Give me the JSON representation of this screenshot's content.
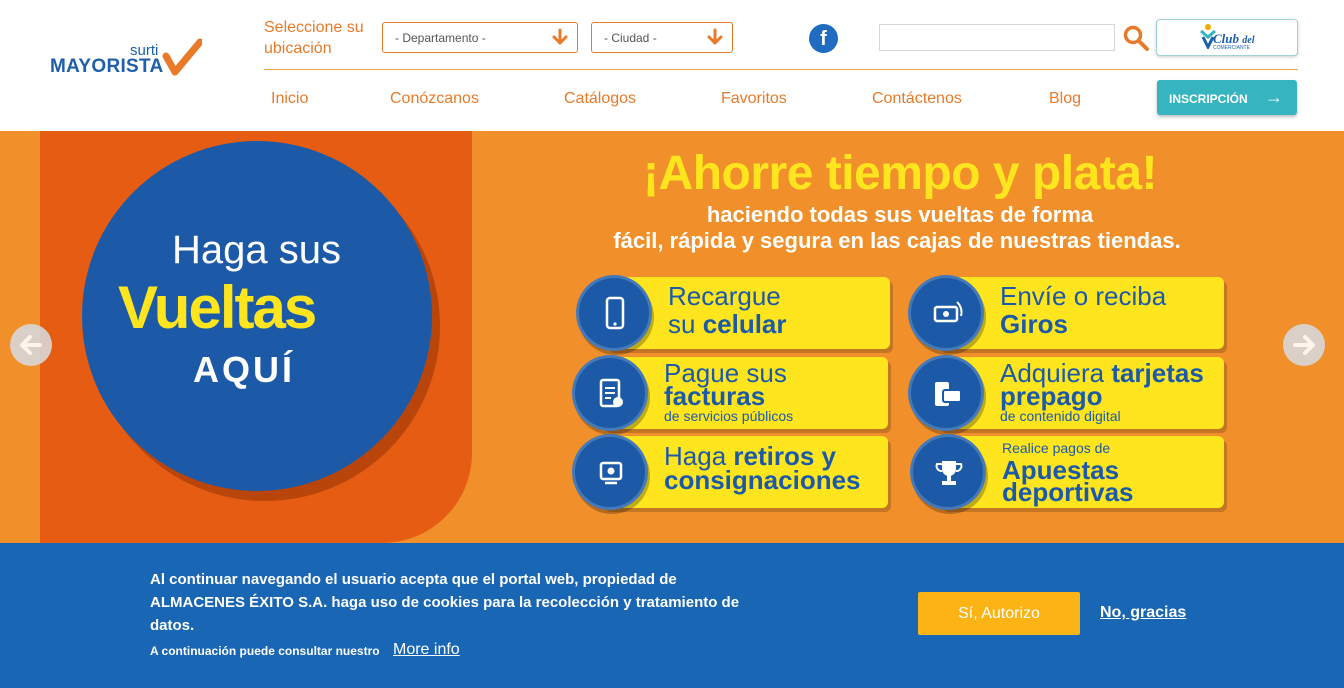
{
  "logo": {
    "small": "surti",
    "main": "MAYORISTA"
  },
  "location": {
    "label": "Seleccione su ubicación",
    "departamento": "- Departamento -",
    "ciudad": "- Ciudad -"
  },
  "social": {
    "facebook_glyph": "f"
  },
  "search": {
    "value": "",
    "placeholder": ""
  },
  "club": {
    "text": "Club",
    "text_del": "del",
    "small": "COMERCIANTE"
  },
  "nav": {
    "items": [
      "Inicio",
      "Conózcanos",
      "Catálogos",
      "Favoritos",
      "Contáctenos",
      "Blog"
    ],
    "inscripcion": "INSCRIPCIÓN"
  },
  "banner": {
    "circle": {
      "line1": "Haga sus",
      "line2": "Vueltas",
      "line3": "AQUÍ"
    },
    "headline": "¡Ahorre tiempo y plata!",
    "sub1": "haciendo todas sus vueltas de forma",
    "sub2": "fácil, rápida y segura en las cajas de nuestras tiendas.",
    "cards": {
      "recargue": {
        "l1": "Recargue",
        "l2a": "su ",
        "l2b": "celular"
      },
      "envie": {
        "l1": "Envíe o reciba",
        "l2": "Giros"
      },
      "pague": {
        "l1": "Pague sus",
        "l2": "facturas",
        "small": "de servicios públicos"
      },
      "adquiera": {
        "l1a": "Adquiera ",
        "l1b": "tarjetas",
        "l2": "prepago",
        "small": "de contenido digital"
      },
      "retiros": {
        "l1a": "Haga ",
        "l1b": "retiros y",
        "l2": "consignaciones"
      },
      "apuestas": {
        "top": "Realice pagos de",
        "l1": "Apuestas",
        "l2": "deportivas"
      }
    }
  },
  "cookie": {
    "text": "Al continuar navegando el usuario acepta que el portal web, propiedad de ALMACENES ÉXITO S.A. haga uso de cookies para la recolección y tratamiento de datos.",
    "small": "A continuación puede consultar nuestro",
    "more_info": "More info",
    "accept": "Sí, Autorizo",
    "decline": "No, gracias"
  },
  "colors": {
    "orange": "#e87a2a",
    "blue": "#1c5aa8",
    "yellow": "#ffe51d",
    "teal": "#36b4c0",
    "cookie_bg": "#1866b4",
    "accept_btn": "#fbb413"
  }
}
